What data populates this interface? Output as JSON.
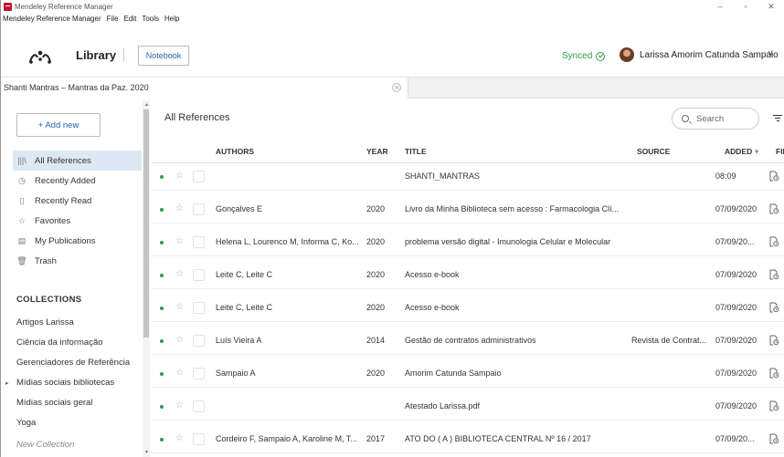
{
  "window": {
    "title": "Mendeley Reference Manager",
    "minimize": "–",
    "restore": "▫",
    "close": "✕"
  },
  "menu": [
    "Mendeley Reference Manager",
    "File",
    "Edit",
    "Tools",
    "Help"
  ],
  "header": {
    "library_label": "Library",
    "notebook_label": "Notebook",
    "sync_status": "Synced",
    "user_name": "Larissa Amorim Catunda Sampaio",
    "user_caret": "∨"
  },
  "tab": {
    "label": "Shanti Mantras – Mantras da Paz. 2020"
  },
  "sidebar": {
    "add_new": "+ Add new",
    "items": [
      {
        "label": "All References",
        "icon": "|||\\",
        "active": true
      },
      {
        "label": "Recently Added",
        "icon": "◷",
        "active": false
      },
      {
        "label": "Recently Read",
        "icon": "▯",
        "active": false
      },
      {
        "label": "Favorites",
        "icon": "☆",
        "active": false
      },
      {
        "label": "My Publications",
        "icon": "▤",
        "active": false
      },
      {
        "label": "Trash",
        "icon": "🗑",
        "active": false
      }
    ],
    "collections_header": "COLLECTIONS",
    "collections": [
      "Artigos Larissa",
      "Ciência da informação",
      "Gerenciadores de Referência",
      "Mídias sociais bibliotecas",
      "Mídias sociais geral",
      "Yoga"
    ],
    "new_collection": "New Collection",
    "collapsed_marker": "▸"
  },
  "main": {
    "title": "All References",
    "search_placeholder": "Search",
    "columns": {
      "authors": "AUTHORS",
      "year": "YEAR",
      "title": "TITLE",
      "source": "SOURCE",
      "added": "ADDED",
      "added_sort": "▾",
      "file": "FIL"
    },
    "rows": [
      {
        "authors": "",
        "year": "",
        "title": "SHANTI_MANTRAS",
        "source": "",
        "added": "08:09"
      },
      {
        "authors": "Gonçalves E",
        "year": "2020",
        "title": "Livro da Minha Biblioteca sem acesso : Farmacologia Clí...",
        "source": "",
        "added": "07/09/2020"
      },
      {
        "authors": "Helena L, Lourenco M, Informa C, Ko...",
        "year": "2020",
        "title": "problema versão digital - Imunologia Celular e Molecular",
        "source": "",
        "added": "07/09/20..."
      },
      {
        "authors": "Leite C, Leite C",
        "year": "2020",
        "title": "Acesso e-book",
        "source": "",
        "added": "07/09/2020"
      },
      {
        "authors": "Leite C, Leite C",
        "year": "2020",
        "title": "Acesso e-book",
        "source": "",
        "added": "07/09/2020"
      },
      {
        "authors": "Luís Vieira A",
        "year": "2014",
        "title": "Gestão de contratos administrativos",
        "source": "Revista de Contrat...",
        "added": "07/09/2020"
      },
      {
        "authors": "Sampaio A",
        "year": "2020",
        "title": "Amorim Catunda Sampaio",
        "source": "",
        "added": "07/09/2020"
      },
      {
        "authors": "",
        "year": "",
        "title": "Atestado Larissa.pdf",
        "source": "",
        "added": "07/09/2020"
      },
      {
        "authors": "Cordeiro F, Sampaio A, Karoline M, T...",
        "year": "2017",
        "title": "ATO DO ( A ) BIBLIOTECA CENTRAL Nº 16 / 2017",
        "source": "",
        "added": "07/09/20..."
      }
    ]
  },
  "colors": {
    "accent_blue": "#2a5db0",
    "synced_green": "#2e9e4a",
    "active_bg": "#dde8f5",
    "brand_red": "#c8102e"
  }
}
